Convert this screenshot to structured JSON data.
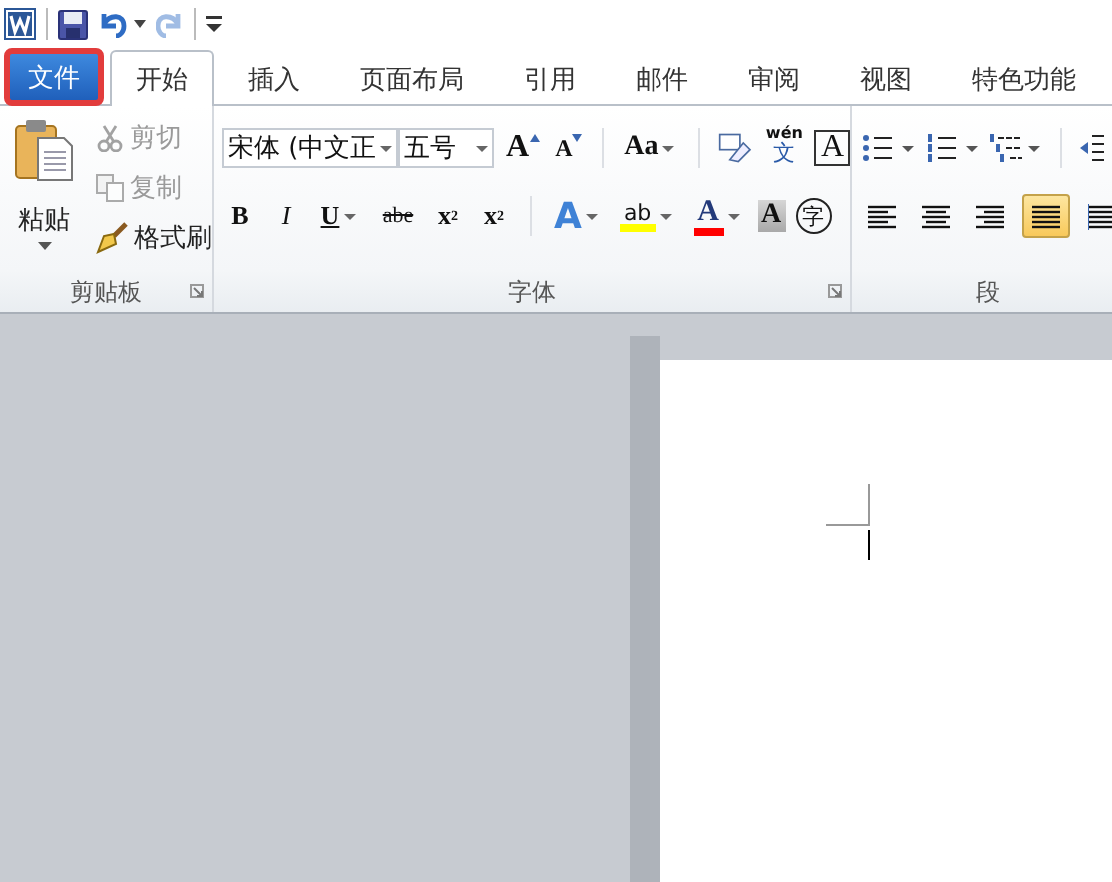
{
  "quick_access": {
    "items": [
      {
        "kind": "app"
      },
      {
        "kind": "save"
      },
      {
        "kind": "undo"
      },
      {
        "kind": "redo",
        "disabled": true
      },
      {
        "kind": "customize"
      }
    ]
  },
  "tabs": [
    {
      "label": "文件",
      "kind": "file",
      "selected": false,
      "highlighted": true
    },
    {
      "label": "开始",
      "kind": "tab",
      "selected": true,
      "highlighted": false
    },
    {
      "label": "插入",
      "kind": "tab",
      "selected": false,
      "highlighted": false
    },
    {
      "label": "页面布局",
      "kind": "tab",
      "selected": false,
      "highlighted": false
    },
    {
      "label": "引用",
      "kind": "tab",
      "selected": false,
      "highlighted": false
    },
    {
      "label": "邮件",
      "kind": "tab",
      "selected": false,
      "highlighted": false
    },
    {
      "label": "审阅",
      "kind": "tab",
      "selected": false,
      "highlighted": false
    },
    {
      "label": "视图",
      "kind": "tab",
      "selected": false,
      "highlighted": false
    },
    {
      "label": "特色功能",
      "kind": "tab",
      "selected": false,
      "highlighted": false
    }
  ],
  "clipboard": {
    "title": "剪贴板",
    "paste": "粘贴",
    "items": [
      {
        "label": "剪切",
        "kind": "cut",
        "disabled": true
      },
      {
        "label": "复制",
        "kind": "copy",
        "disabled": true
      },
      {
        "label": "格式刷",
        "kind": "brush",
        "disabled": false
      }
    ]
  },
  "font": {
    "title": "字体",
    "font_name": "宋体 (中文正",
    "font_size": "五号",
    "row1": [
      {
        "kind": "grow",
        "label": "A"
      },
      {
        "kind": "shrink",
        "label": "A"
      },
      {
        "kind": "case",
        "label": "Aa"
      },
      {
        "kind": "clear"
      },
      {
        "kind": "phonetic",
        "label": "wén",
        "sub": "文"
      },
      {
        "kind": "border",
        "label": "A"
      }
    ],
    "row2": [
      {
        "kind": "bold",
        "label": "B"
      },
      {
        "kind": "italic",
        "label": "I"
      },
      {
        "kind": "underline",
        "label": "U"
      },
      {
        "kind": "strike",
        "label": "abe"
      },
      {
        "kind": "sub",
        "label": "x",
        "mark": "2"
      },
      {
        "kind": "sup",
        "label": "x",
        "mark": "2"
      },
      {
        "kind": "effect",
        "label": "A"
      },
      {
        "kind": "highlight",
        "label": "ab",
        "color": "#ffff00"
      },
      {
        "kind": "fontcolor",
        "label": "A",
        "color": "#ff0000"
      },
      {
        "kind": "shading",
        "label": "A"
      },
      {
        "kind": "enclose",
        "label": "字"
      }
    ]
  },
  "paragraph": {
    "title": "段",
    "row1": [
      {
        "kind": "bullets"
      },
      {
        "kind": "numbering"
      },
      {
        "kind": "multilevel"
      },
      {
        "kind": "indent"
      }
    ],
    "row2": [
      {
        "kind": "left",
        "selected": false
      },
      {
        "kind": "center",
        "selected": false
      },
      {
        "kind": "right",
        "selected": false
      },
      {
        "kind": "justify",
        "selected": true
      },
      {
        "kind": "distribute",
        "selected": false
      }
    ]
  }
}
